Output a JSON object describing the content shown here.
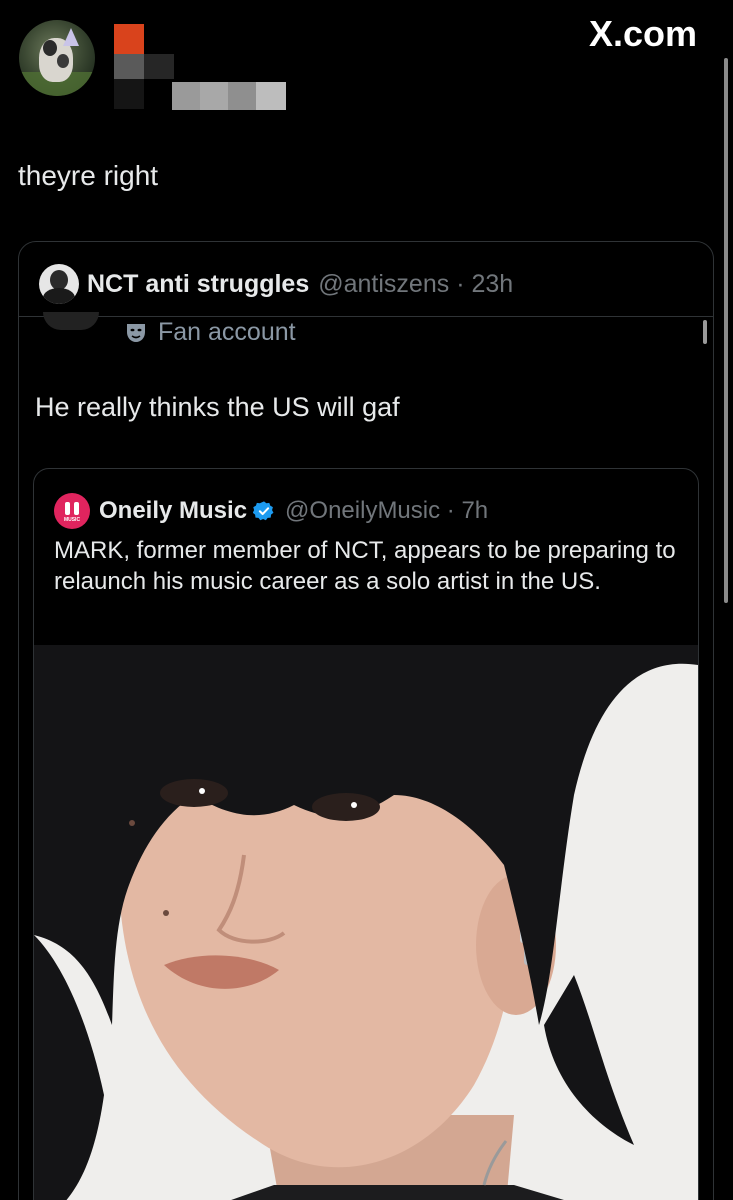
{
  "header": {
    "site_label": "X.com"
  },
  "tweet": {
    "text": "theyre right"
  },
  "quoted_tweet": {
    "display_name": "NCT anti struggles",
    "meta": "@antiszens · 23h",
    "account_label": "Fan account",
    "text": "He really thinks the US will gaf",
    "nested_quote": {
      "display_name": "Oneily Music",
      "logo_caption": "MUSIC",
      "meta": "@OneilyMusic · 7h",
      "text": "MARK, former member of NCT, appears to be preparing to relaunch his music career as a solo artist in the US."
    }
  },
  "colors": {
    "background": "#000000",
    "border": "#2f3336",
    "muted": "#71767b",
    "brand_red": "#e0245e",
    "verified_blue": "#1d9bf0"
  }
}
